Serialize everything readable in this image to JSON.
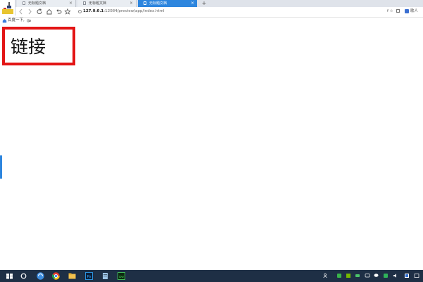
{
  "tabs": [
    {
      "label": "无标题文档",
      "state": "inactive"
    },
    {
      "label": "无标题文档",
      "state": "inactive"
    },
    {
      "label": "无标题文档",
      "state": "active"
    }
  ],
  "tab_close_glyph": "×",
  "new_tab_glyph": "+",
  "address": {
    "host": "127.0.0.1",
    "path": ":12084/preview/app/index.html"
  },
  "toolbar_right": {
    "text": "f ☆",
    "user_label": "歌人"
  },
  "bookmarks": {
    "home_label": "百度一下,"
  },
  "page": {
    "link_text": "链接"
  },
  "colors": {
    "accent": "#2e86de",
    "link_border": "#e31515",
    "taskbar": "#1e2f45"
  },
  "taskbar_icons": [
    "windows-start-icon",
    "cortana-search-icon",
    "browser-360-icon",
    "chrome-icon",
    "file-explorer-icon",
    "photoshop-icon",
    "notepad-icon",
    "dreamweaver-icon"
  ],
  "tray_icons": [
    "people-icon",
    "green-app-icon",
    "nvidia-icon",
    "cloud-icon",
    "chat-icon",
    "wechat-icon",
    "update-icon",
    "volume-icon",
    "network-icon"
  ]
}
